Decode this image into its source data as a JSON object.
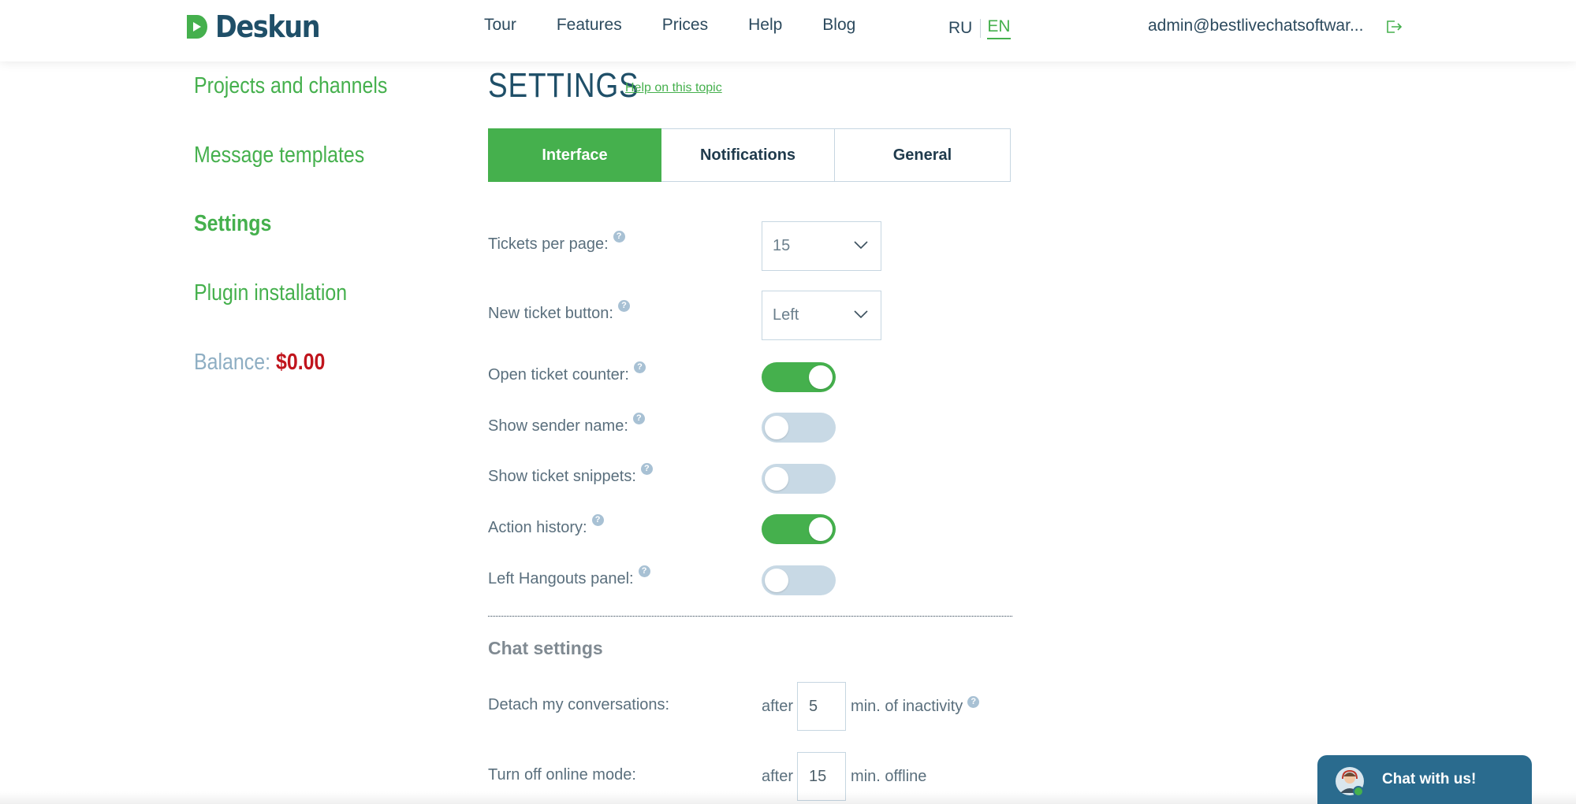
{
  "header": {
    "logo_text": "Deskun",
    "nav": [
      "Tour",
      "Features",
      "Prices",
      "Help",
      "Blog"
    ],
    "lang_ru": "RU",
    "lang_en": "EN",
    "account": "admin@bestlivechatsoftwar..."
  },
  "sidebar": {
    "items": [
      {
        "label": "Projects and channels"
      },
      {
        "label": "Message templates"
      },
      {
        "label": "Settings",
        "active": true
      },
      {
        "label": "Plugin installation"
      }
    ],
    "balance_label": "Balance:",
    "balance_amount": "$0.00"
  },
  "main": {
    "title": "SETTINGS",
    "help_link": "Help on this topic",
    "tabs": [
      {
        "label": "Interface",
        "active": true
      },
      {
        "label": "Notifications"
      },
      {
        "label": "General"
      }
    ],
    "settings": {
      "tickets_per_page": {
        "label": "Tickets per page:",
        "value": "15"
      },
      "new_ticket_button": {
        "label": "New ticket button:",
        "value": "Left"
      },
      "open_ticket_counter": {
        "label": "Open ticket counter:",
        "on": true
      },
      "show_sender_name": {
        "label": "Show sender name:",
        "on": false
      },
      "show_ticket_snippets": {
        "label": "Show ticket snippets:",
        "on": false
      },
      "action_history": {
        "label": "Action history:",
        "on": true
      },
      "left_hangouts_panel": {
        "label": "Left Hangouts panel:",
        "on": false
      }
    },
    "chat_settings": {
      "title": "Chat settings",
      "detach": {
        "label": "Detach my conversations:",
        "prefix": "after",
        "value": "5",
        "suffix": "min. of inactivity"
      },
      "offline": {
        "label": "Turn off online mode:",
        "prefix": "after",
        "value": "15",
        "suffix": "min. offline"
      }
    },
    "help_icon": "?"
  },
  "chat_widget": {
    "label": "Chat with us!"
  },
  "colors": {
    "accent": "#45b04d",
    "brand_dark": "#1f4f68",
    "balance": "#c0151d",
    "widget": "#2a6b8e"
  }
}
